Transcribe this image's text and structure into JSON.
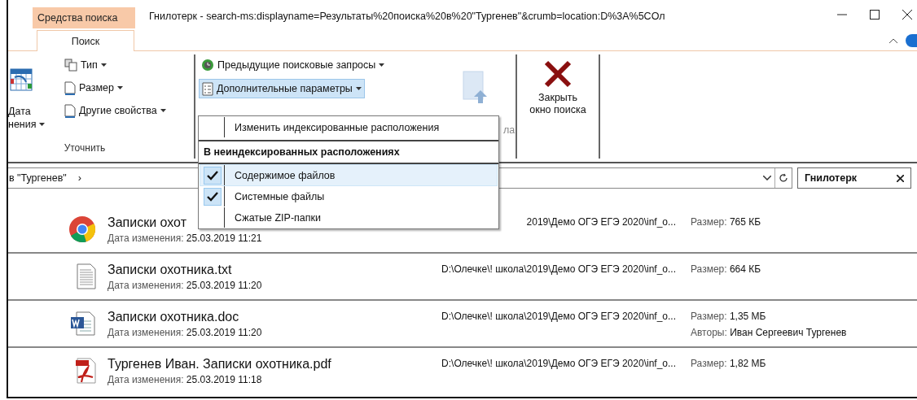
{
  "window": {
    "title": "Гнилотерк - search-ms:displayname=Результаты%20поиска%20в%20\"Тургенев\"&crumb=location:D%3A%5COл"
  },
  "contextual_tab": {
    "label": "Средства поиска"
  },
  "ribbon_tabs": [
    {
      "label": "Поиск",
      "selected": true
    }
  ],
  "ribbon": {
    "date_button": {
      "lines": [
        "Дата",
        "нения"
      ]
    },
    "refine": {
      "items": [
        {
          "label": "Тип"
        },
        {
          "label": "Размер"
        },
        {
          "label": "Другие свойства"
        }
      ],
      "group_label": "Уточнить"
    },
    "options": {
      "items": [
        {
          "label": "Предыдущие поисковые запросы",
          "active": false
        },
        {
          "label": "Дополнительные параметры",
          "active": true
        }
      ],
      "fragment": "ла"
    },
    "close": {
      "lines": [
        "Закрыть",
        "окно поиска"
      ]
    }
  },
  "menu": {
    "items": [
      {
        "kind": "command",
        "label": "Изменить индексированные расположения"
      },
      {
        "kind": "header",
        "label": "В неиндексированных расположениях"
      },
      {
        "kind": "check",
        "label": "Содержимое файлов",
        "checked": true,
        "selected": true
      },
      {
        "kind": "check",
        "label": "Системные файлы",
        "checked": true,
        "selected": false
      },
      {
        "kind": "check",
        "label": "Сжатые ZIP-папки",
        "checked": false,
        "selected": false
      }
    ]
  },
  "address": {
    "breadcrumb": "в \"Тургенев\"",
    "separator": "›"
  },
  "search": {
    "value": "Гнилотерк"
  },
  "results": [
    {
      "kind": "html",
      "name": "Записки охот",
      "modified_label": "Дата изменения:",
      "modified": "25.03.2019 11:21",
      "path": "2019\\Демо ОГЭ ЕГЭ 2020\\inf_o...",
      "size_label": "Размер:",
      "size": "765 КБ"
    },
    {
      "kind": "text",
      "name": "Записки охотника.txt",
      "modified_label": "Дата изменения:",
      "modified": "25.03.2019 11:20",
      "path": "D:\\Олечке\\! школа\\2019\\Демо ОГЭ ЕГЭ 2020\\inf_o...",
      "size_label": "Размер:",
      "size": "664 КБ"
    },
    {
      "kind": "word",
      "name": "Записки охотника.doc",
      "modified_label": "Дата изменения:",
      "modified": "25.03.2019 11:20",
      "path": "D:\\Олечке\\! школа\\2019\\Демо ОГЭ ЕГЭ 2020\\inf_o...",
      "size_label": "Размер:",
      "size": "1,35 МБ",
      "authors_label": "Авторы:",
      "authors": "Иван Сергеевич Тургенев"
    },
    {
      "kind": "pdf",
      "name": "Тургенев Иван. Записки охотника.pdf",
      "modified_label": "Дата изменения:",
      "modified": "25.03.2019 11:18",
      "path": "D:\\Олечке\\! школа\\2019\\Демо ОГЭ ЕГЭ 2020\\inf_o...",
      "size_label": "Размер:",
      "size": "1,82 МБ"
    }
  ]
}
